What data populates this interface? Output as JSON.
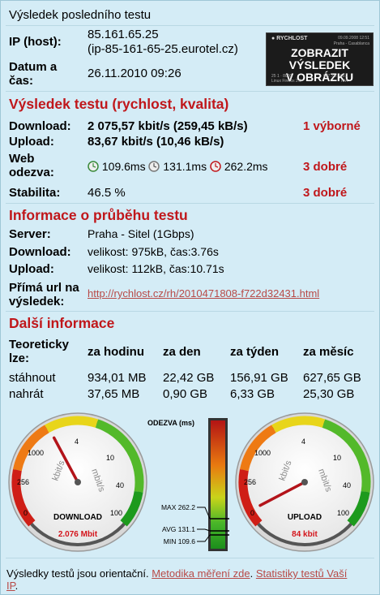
{
  "header": {
    "title": "Výsledek posledního testu",
    "ip_label": "IP (host):",
    "ip_value": "85.161.65.25",
    "host_value": "(ip-85-161-65-25.eurotel.cz)",
    "date_label_1": "Datum a",
    "date_label_2": "čas:",
    "date_value": "26.11.2010 09:26"
  },
  "badge": {
    "logo": "RYCHLOST",
    "line1": "ZOBRAZIT VÝSLEDEK",
    "line2": "V OBRÁZKU",
    "tiny_top": "09.09.2008 12:51",
    "tiny_server": "Praha - Casablanca",
    "tiny_row1": "25 1 · 8000",
    "tiny_row2": "607.7 k · 63.1",
    "tiny_row3": "Linux Firefox 2.0",
    "tiny_row4": "N/A"
  },
  "results": {
    "heading": "Výsledek testu (rychlost, kvalita)",
    "download_label": "Download:",
    "download_value": "2 075,57 kbit/s (259,45 kB/s)",
    "download_rating": "1 výborné",
    "upload_label": "Upload:",
    "upload_value": "83,67 kbit/s (10,46 kB/s)",
    "web_label_1": "Web",
    "web_label_2": "odezva:",
    "web_values": [
      "109.6ms",
      "131.1ms",
      "262.2ms"
    ],
    "web_rating": "3 dobré",
    "stab_label": "Stabilita:",
    "stab_value": "46.5 %",
    "stab_rating": "3 dobré"
  },
  "progress": {
    "heading": "Informace o průběhu testu",
    "server_label": "Server:",
    "server_value": "Praha - Sitel (1Gbps)",
    "download_label": "Download:",
    "download_value": "velikost: 975kB, čas:3.76s",
    "upload_label": "Upload:",
    "upload_value": "velikost: 112kB, čas:10.71s",
    "url_label_1": "Přímá url na",
    "url_label_2": "výsledek:",
    "url_value": "http://rychlost.cz/rh/2010471808-f722d32431.html"
  },
  "more": {
    "heading": "Další informace",
    "col0_1": "Teoreticky",
    "col0_2": "lze:",
    "columns": [
      "za hodinu",
      "za den",
      "za týden",
      "za měsíc"
    ],
    "rows": [
      {
        "label": "stáhnout",
        "values": [
          "934,01 MB",
          "22,42 GB",
          "156,91 GB",
          "627,65 GB"
        ]
      },
      {
        "label": "nahrát",
        "values": [
          "37,65 MB",
          "0,90 GB",
          "6,33 GB",
          "25,30 GB"
        ]
      }
    ]
  },
  "gauges": {
    "download": {
      "caption": "DOWNLOAD",
      "value_text": "2.076 Mbit",
      "value_kbit": 2076,
      "ticks": [
        "0",
        "256",
        "1000",
        "4",
        "10",
        "40",
        "100"
      ],
      "unit_left": "kbit/s",
      "unit_right": "mbit/s"
    },
    "upload": {
      "caption": "UPLOAD",
      "value_text": "84 kbit",
      "value_kbit": 84,
      "ticks": [
        "0",
        "256",
        "1000",
        "4",
        "10",
        "40",
        "100"
      ],
      "unit_left": "kbit/s",
      "unit_right": "mbit/s"
    },
    "response": {
      "title": "ODEZVA (ms)",
      "max_label": "MAX 262.2",
      "avg_label": "AVG 131.1",
      "min_label": "MIN 109.6"
    }
  },
  "footer": {
    "text": "Výsledky testů jsou orientační.",
    "link1": "Metodika měření zde",
    "sep": ".",
    "link2_a": "Statistiky testů Vaší",
    "link2_b": "IP",
    "end": "."
  },
  "colors": {
    "background": "#d4ecf6",
    "accent_red": "#c0171b",
    "link": "#b84a47"
  }
}
